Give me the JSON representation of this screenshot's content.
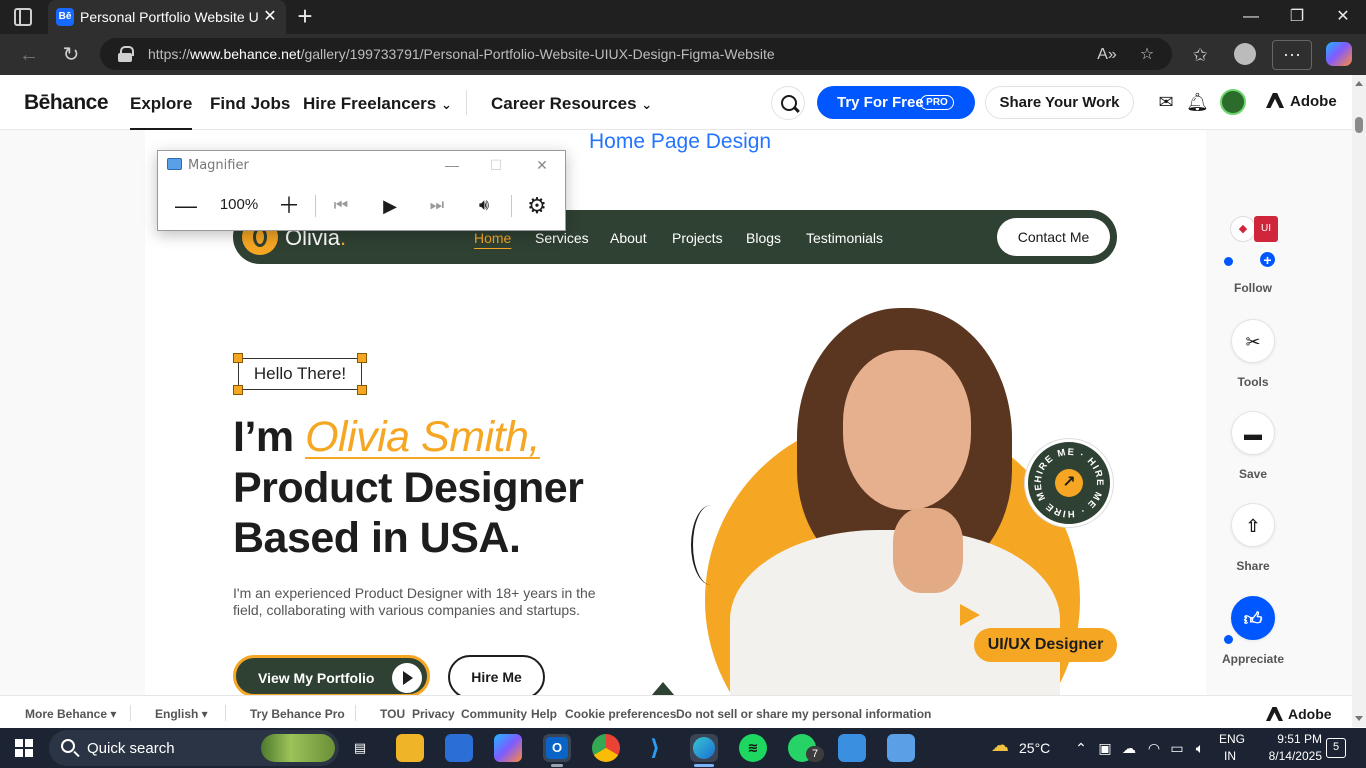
{
  "browser": {
    "tab_title": "Personal Portfolio Website UIUX Design",
    "tab_favicon": "Bē",
    "new_tab_label": "+",
    "url_prefix": "https://",
    "url_host": "www.behance.net",
    "url_path": "/gallery/199733791/Personal-Portfolio-Website-UIUX-Design-Figma-Website",
    "more_label": "···"
  },
  "behance": {
    "logo": "Bēhance",
    "nav": [
      "Explore",
      "Find Jobs",
      "Hire Freelancers",
      "Career Resources"
    ],
    "active_nav": "Explore",
    "try_label": "Try For Free",
    "pro_badge": "PRO",
    "share_label": "Share Your Work",
    "adobe_label": "Adobe",
    "accent_color": "#0057ff"
  },
  "project": {
    "section_title": "Home Page Design",
    "site_logo": "Olivia",
    "site_logo_dot": ".",
    "site_nav": [
      "Home",
      "Services",
      "About",
      "Projects",
      "Blogs",
      "Testimonials"
    ],
    "contact_label": "Contact Me",
    "hello": "Hello There!",
    "hero_im": "I’m ",
    "hero_name": "Olivia Smith,",
    "hero_line2": "Product Designer",
    "hero_line3": "Based in USA.",
    "hero_desc_1": "I'm an experienced Product Designer with 18+ years in the",
    "hero_desc_2": "field, collaborating with various companies and startups.",
    "cta_portfolio": "View My Portfolio",
    "cta_hire": "Hire Me",
    "badge_ring_text": "HIRE ME · HIRE ME · HIRE ME ·",
    "badge_arrow": "↗",
    "role_badge": "UI/UX Designer",
    "brand_green": "#2f4133",
    "brand_orange": "#f5a623"
  },
  "rail": {
    "owner_a1": "◆",
    "owner_a2": "UI",
    "follow": "Follow",
    "tools": "Tools",
    "save": "Save",
    "share": "Share",
    "appreciate": "Appreciate"
  },
  "footer": {
    "more": "More Behance ▾",
    "language": "English ▾",
    "try_pro": "Try Behance Pro",
    "links": [
      "TOU",
      "Privacy",
      "Community",
      "Help",
      "Cookie preferences",
      "Do not sell or share my personal information"
    ],
    "adobe": "Adobe"
  },
  "magnifier": {
    "title": "Magnifier",
    "zoom": "100%"
  },
  "taskbar": {
    "search_label": "Quick search",
    "apps": [
      "task-view",
      "file-explorer",
      "microsoft-store",
      "copilot",
      "outlook",
      "chrome",
      "vscode",
      "edge",
      "spotify",
      "whatsapp",
      "paint",
      "remote-desktop"
    ],
    "whatsapp_badge": "7",
    "temperature": "25°C",
    "lang_1": "ENG",
    "lang_2": "IN",
    "time": "9:51 PM",
    "date": "8/14/2025",
    "notif_count": "5"
  }
}
